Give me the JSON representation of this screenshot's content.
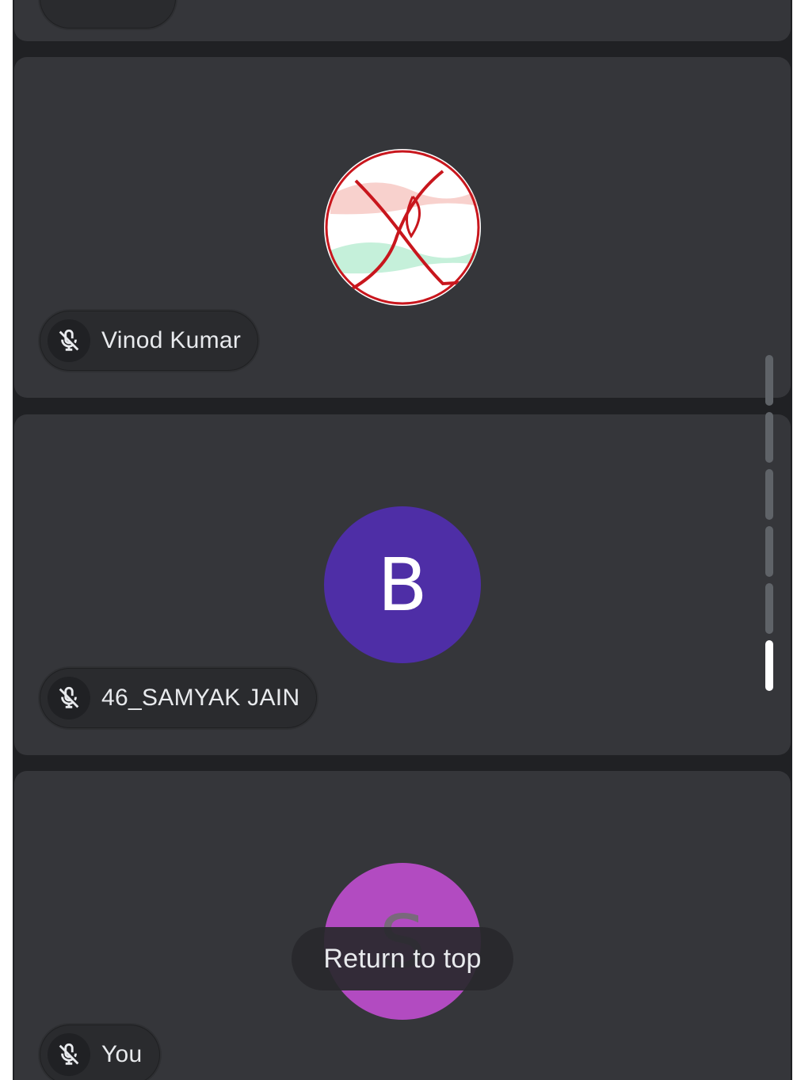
{
  "participants": [
    {
      "name": "",
      "muted": true,
      "avatar_type": "partial"
    },
    {
      "name": "Vinod Kumar",
      "muted": true,
      "avatar_type": "photo",
      "avatar_description_icon": "logo-icon"
    },
    {
      "name": "46_SAMYAK JAIN",
      "muted": true,
      "avatar_type": "initial",
      "avatar_initial": "B",
      "avatar_color": "#4e2ea6"
    },
    {
      "name": "You",
      "muted": true,
      "avatar_type": "initial",
      "avatar_initial": "S",
      "avatar_color": "#b24bc1"
    }
  ],
  "scroll": {
    "segments": 6,
    "active_segment": 6
  },
  "return_to_top": {
    "label": "Return to top"
  },
  "colors": {
    "background": "#202124",
    "tile": "#35363a",
    "text": "#e8eaed"
  }
}
